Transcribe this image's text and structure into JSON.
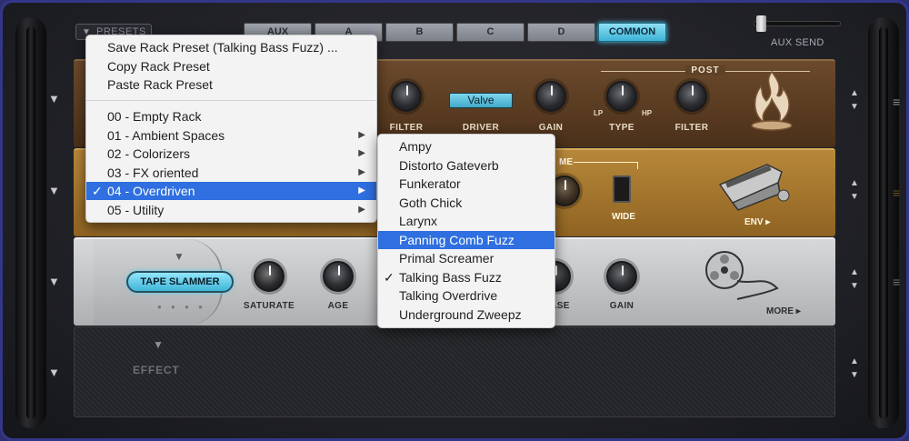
{
  "top_bar": {
    "presets_label": "PRESETS",
    "tabs": [
      {
        "label": "AUX"
      },
      {
        "label": "A"
      },
      {
        "label": "B"
      },
      {
        "label": "C"
      },
      {
        "label": "D"
      },
      {
        "label": "COMMON",
        "active": true
      }
    ],
    "aux_send_label": "AUX SEND"
  },
  "rack": {
    "amp": {
      "post_label": "POST",
      "driver_value": "Valve",
      "knob_labels": [
        "FILTER",
        "DRIVER",
        "GAIN",
        "TYPE",
        "FILTER"
      ],
      "type_sub_labels": [
        "LP",
        "HP"
      ]
    },
    "wah": {
      "wide_label": "WIDE",
      "env_label": "ENV ▸",
      "partial_label": "ME"
    },
    "tape_slammer": {
      "name": "TAPE SLAMMER",
      "knob_labels": [
        "SATURATE",
        "AGE",
        "ASE",
        "GAIN"
      ],
      "more_label": "MORE ▸"
    },
    "empty_slot": {
      "label": "EFFECT"
    }
  },
  "menu_main": {
    "actions": [
      {
        "label": "Save Rack Preset (Talking Bass Fuzz) ..."
      },
      {
        "label": "Copy Rack Preset"
      },
      {
        "label": "Paste Rack Preset"
      }
    ],
    "folders": [
      {
        "label": "00 - Empty Rack",
        "submenu": false
      },
      {
        "label": "01 - Ambient Spaces",
        "submenu": true
      },
      {
        "label": "02 - Colorizers",
        "submenu": true
      },
      {
        "label": "03 - FX oriented",
        "submenu": true
      },
      {
        "label": "04 - Overdriven",
        "submenu": true,
        "checked": true,
        "highlighted": true
      },
      {
        "label": "05 - Utility",
        "submenu": true
      }
    ]
  },
  "menu_sub": {
    "items": [
      {
        "label": "Ampy"
      },
      {
        "label": "Distorto Gateverb"
      },
      {
        "label": "Funkerator"
      },
      {
        "label": "Goth Chick"
      },
      {
        "label": "Larynx"
      },
      {
        "label": "Panning Comb Fuzz",
        "highlighted": true
      },
      {
        "label": "Primal Screamer"
      },
      {
        "label": "Talking Bass Fuzz",
        "checked": true
      },
      {
        "label": "Talking Overdrive"
      },
      {
        "label": "Underground Zweepz"
      }
    ]
  },
  "glyphs": {
    "check": "✓",
    "submenu_arrow": "▶",
    "row_handle": "≡",
    "down": "▼",
    "up": "▲"
  },
  "colors": {
    "highlight": "#2f6fe0",
    "accent_cyan": "#3cb3d6",
    "frame_border": "#34368a"
  }
}
